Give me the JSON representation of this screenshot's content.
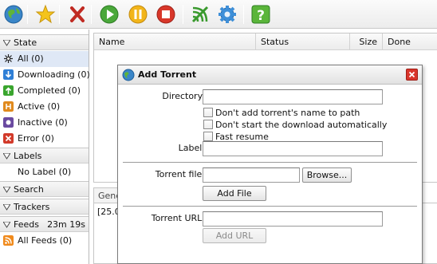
{
  "toolbar": {
    "buttons": [
      {
        "name": "globe-icon"
      },
      {
        "name": "star-icon"
      },
      {
        "name": "remove-icon"
      },
      {
        "name": "start-icon"
      },
      {
        "name": "pause-icon"
      },
      {
        "name": "stop-icon"
      },
      {
        "name": "connection-icon"
      },
      {
        "name": "gear-icon"
      },
      {
        "name": "help-icon"
      }
    ]
  },
  "sidebar": {
    "state_header": "State",
    "state_items": [
      {
        "label": "All (0)",
        "selected": true
      },
      {
        "label": "Downloading (0)"
      },
      {
        "label": "Completed (0)"
      },
      {
        "label": "Active (0)"
      },
      {
        "label": "Inactive (0)"
      },
      {
        "label": "Error (0)"
      }
    ],
    "labels_header": "Labels",
    "labels_items": [
      {
        "label": "No Label (0)"
      }
    ],
    "search_header": "Search",
    "trackers_header": "Trackers",
    "feeds_header": "Feeds",
    "feeds_timer": "23m 19s",
    "feeds_items": [
      {
        "label": "All Feeds (0)"
      }
    ]
  },
  "list": {
    "columns": [
      "Name",
      "Status",
      "Size",
      "Done"
    ]
  },
  "details": {
    "tab": "General",
    "log": "[25.0"
  },
  "dialog": {
    "title": "Add Torrent",
    "directory_label": "Directory:",
    "directory_value": "",
    "options": [
      {
        "label": "Don't add torrent's name to path",
        "checked": false
      },
      {
        "label": "Don't start the download automatically",
        "checked": false
      },
      {
        "label": "Fast resume",
        "checked": false
      }
    ],
    "label_label": "Label:",
    "label_value": "",
    "torrent_file_label": "Torrent file:",
    "torrent_file_value": "",
    "browse_button": "Browse...",
    "add_file_button": "Add File",
    "torrent_url_label": "Torrent URL:",
    "torrent_url_value": "",
    "add_url_button": "Add URL"
  },
  "colors": {
    "selection": "#dfe8f6",
    "close_red": "#d9352b",
    "downloading_blue": "#2f7fd6",
    "completed_green": "#3aa52e",
    "active_orange": "#e08a1e",
    "inactive_purple": "#6a4aa0",
    "error_red": "#d23a2a",
    "rss_orange": "#f08a1c"
  }
}
